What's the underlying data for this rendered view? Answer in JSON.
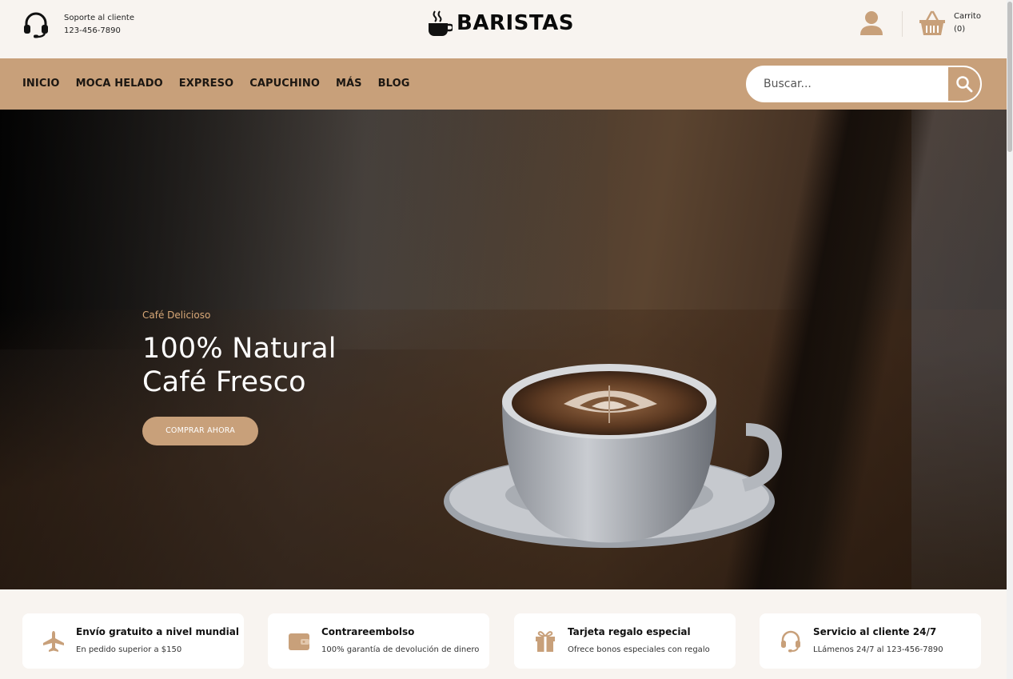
{
  "header": {
    "support_label": "Soporte al cliente",
    "support_phone": "123-456-7890",
    "brand": "BARISTAS",
    "cart_label": "Carrito",
    "cart_count": "(0)"
  },
  "nav": {
    "items": [
      {
        "label": "INICIO"
      },
      {
        "label": "MOCA HELADO"
      },
      {
        "label": "EXPRESO"
      },
      {
        "label": "CAPUCHINO"
      },
      {
        "label": "MÁS"
      },
      {
        "label": "BLOG"
      }
    ],
    "search_placeholder": "Buscar..."
  },
  "hero": {
    "kicker": "Café Delicioso",
    "title_line1": "100% Natural",
    "title_line2": "Café Fresco",
    "cta": "COMPRAR AHORA"
  },
  "features": [
    {
      "icon": "plane-icon",
      "title": "Envío gratuito a nivel mundial",
      "subtitle": "En pedido superior a $150"
    },
    {
      "icon": "wallet-icon",
      "title": "Contrareembolso",
      "subtitle": "100% garantía de devolución de dinero"
    },
    {
      "icon": "gift-icon",
      "title": "Tarjeta regalo especial",
      "subtitle": "Ofrece bonos especiales con regalo"
    },
    {
      "icon": "headset-icon",
      "title": "Servicio al cliente 24/7",
      "subtitle": "LLámenos 24/7 al 123-456-7890"
    }
  ],
  "colors": {
    "accent": "#c8a07a",
    "background": "#f8f4f0",
    "text": "#111111"
  }
}
